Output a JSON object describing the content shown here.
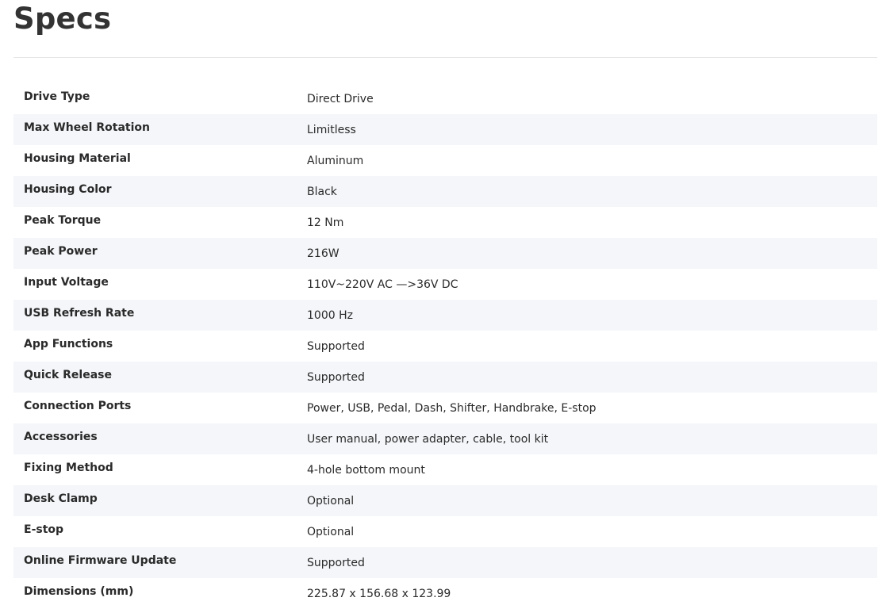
{
  "page": {
    "title": "Specs"
  },
  "colors": {
    "row_shade": "#f4f6f9",
    "divider": "#e6e6e6",
    "text": "#2a2a2a"
  },
  "specs": [
    {
      "label": "Drive Type",
      "value": "Direct Drive"
    },
    {
      "label": "Max Wheel Rotation",
      "value": "Limitless"
    },
    {
      "label": "Housing Material",
      "value": "Aluminum"
    },
    {
      "label": "Housing Color",
      "value": "Black"
    },
    {
      "label": "Peak Torque",
      "value": "12 Nm"
    },
    {
      "label": "Peak Power",
      "value": "216W"
    },
    {
      "label": "Input Voltage",
      "value": "110V~220V AC —>36V DC"
    },
    {
      "label": "USB Refresh Rate",
      "value": "1000 Hz"
    },
    {
      "label": "App Functions",
      "value": "Supported"
    },
    {
      "label": "Quick Release",
      "value": "Supported"
    },
    {
      "label": "Connection Ports",
      "value": "Power, USB, Pedal, Dash, Shifter, Handbrake, E-stop"
    },
    {
      "label": "Accessories",
      "value": "User manual, power adapter, cable, tool kit"
    },
    {
      "label": "Fixing Method",
      "value": "4-hole bottom mount"
    },
    {
      "label": "Desk Clamp",
      "value": "Optional"
    },
    {
      "label": "E-stop",
      "value": "Optional"
    },
    {
      "label": "Online Firmware Update",
      "value": "Supported"
    },
    {
      "label": "Dimensions (mm)",
      "value": "225.87 x 156.68 x 123.99"
    }
  ]
}
